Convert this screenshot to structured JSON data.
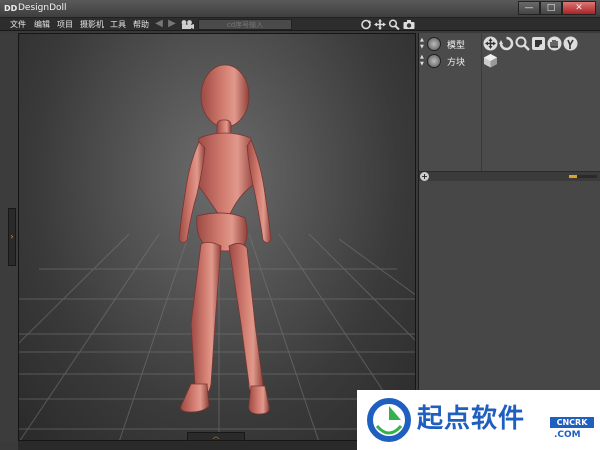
{
  "window": {
    "title": "DesignDoll",
    "app_icon": "DD",
    "min": "—",
    "max": "□",
    "close": "✕"
  },
  "menu": {
    "items": [
      "文件",
      "编辑",
      "项目",
      "摄影机",
      "工具",
      "帮助"
    ],
    "camera_input_placeholder": "cd序号输入"
  },
  "viewport": {
    "left_toggle": "›",
    "bottom_toggle": "︿"
  },
  "panel": {
    "rows": [
      {
        "label": "模型"
      },
      {
        "label": "方块"
      }
    ],
    "plus": "+",
    "slider_fraction": 0.3
  },
  "watermark": {
    "brand": "起点软件",
    "tag": "CNCRK",
    "domain": ".COM"
  },
  "colors": {
    "accent": "#e0a020",
    "doll": "#c8685e",
    "watermark_blue": "#1f5fc0"
  }
}
